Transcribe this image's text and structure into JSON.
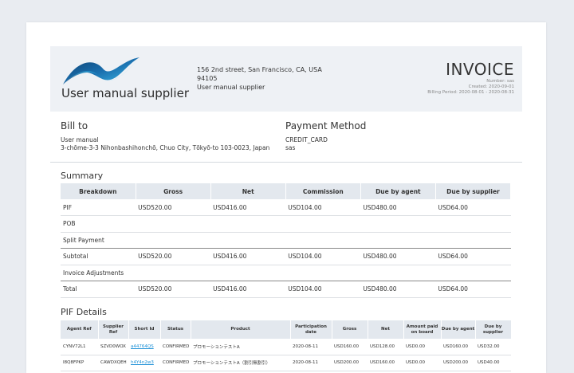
{
  "supplier": {
    "name": "User manual supplier",
    "address_line1": "156 2nd street, San Francisco, CA, USA",
    "address_line2": "94105",
    "address_name": "User manual supplier"
  },
  "invoice": {
    "title": "INVOICE",
    "number": "Number: sas",
    "created": "Created: 2020-09-01",
    "billing_period": "Billing Period: 2020-08-01 - 2020-08-31"
  },
  "bill_to": {
    "heading": "Bill to",
    "name": "User manual",
    "address": "3-chōme-3-3 Nihonbashihonchō, Chuo City, Tōkyō-to 103-0023, Japan"
  },
  "payment": {
    "heading": "Payment Method",
    "method": "CREDIT_CARD",
    "note": "sas"
  },
  "summary": {
    "heading": "Summary",
    "columns": [
      "Breakdown",
      "Gross",
      "Net",
      "Commission",
      "Due by agent",
      "Due by supplier"
    ],
    "rows": [
      [
        "PIF",
        "USD520.00",
        "USD416.00",
        "USD104.00",
        "USD480.00",
        "USD64.00"
      ],
      [
        "POB",
        "",
        "",
        "",
        "",
        ""
      ],
      [
        "Split Payment",
        "",
        "",
        "",
        "",
        ""
      ],
      [
        "Subtotal",
        "USD520.00",
        "USD416.00",
        "USD104.00",
        "USD480.00",
        "USD64.00"
      ],
      [
        "Invoice Adjustments",
        "",
        "",
        "",
        "",
        ""
      ],
      [
        "Total",
        "USD520.00",
        "USD416.00",
        "USD104.00",
        "USD480.00",
        "USD64.00"
      ]
    ]
  },
  "pif": {
    "heading": "PIF Details",
    "columns": [
      "Agent Ref",
      "Supplier Ref",
      "Short Id",
      "Status",
      "Product",
      "Participation date",
      "Gross",
      "Net",
      "Amount paid on board",
      "Due by agent",
      "Due by supplier"
    ],
    "rows": [
      [
        "CYNV72L1",
        "SZVD0WOX",
        "a44764QS",
        "CONFIRMED",
        "プロモーションテストA",
        "2020-08-11",
        "USD160.00",
        "USD128.00",
        "USD0.00",
        "USD160.00",
        "USD32.00"
      ],
      [
        "I8Q8FPKP",
        "CAWDXQEH",
        "h4Y4n2w3",
        "CONFIRMED",
        "プロモーションテストA（割引無割引）",
        "2020-08-11",
        "USD200.00",
        "USD160.00",
        "USD0.00",
        "USD200.00",
        "USD40.00"
      ]
    ]
  },
  "colors": {
    "header_bg": "#eef1f5",
    "table_header_bg": "#e3e8ee",
    "link": "#1a8fd6",
    "logo_dark": "#0d4a7a",
    "logo_light": "#34b6e8"
  }
}
